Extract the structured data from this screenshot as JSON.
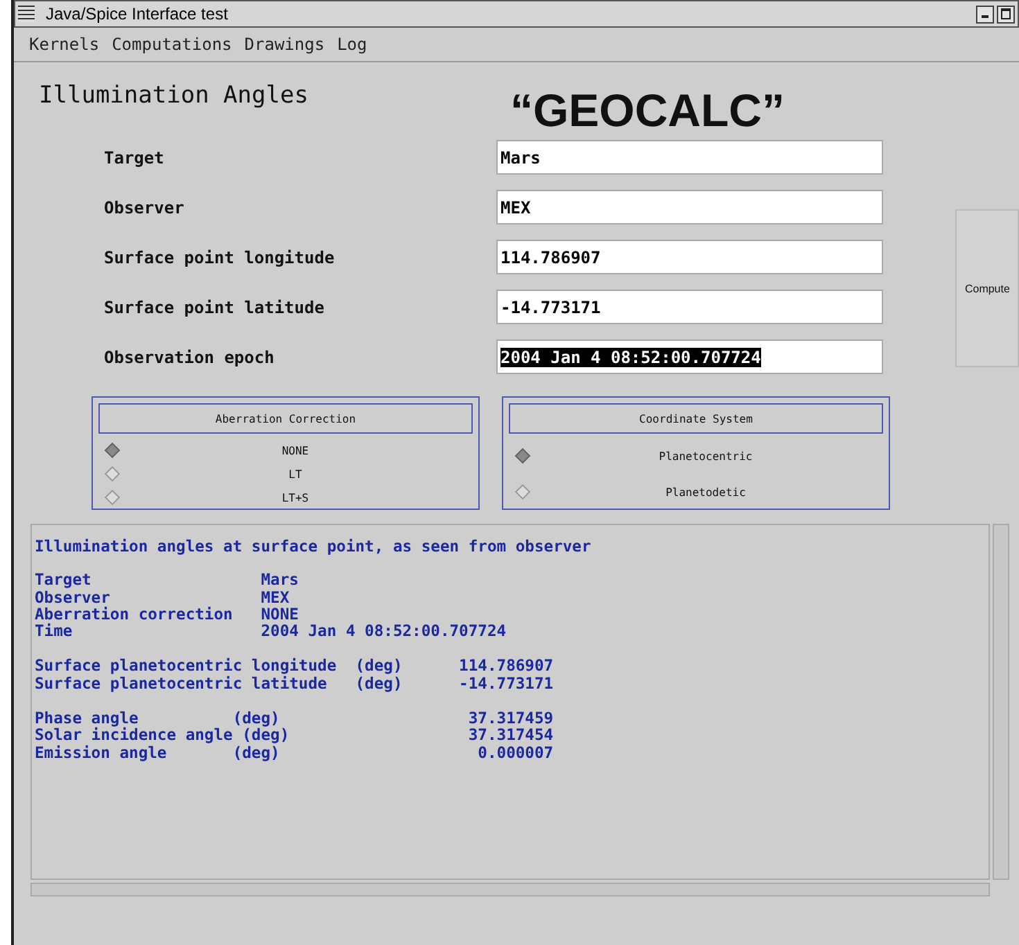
{
  "window": {
    "title": "Java/Spice Interface test"
  },
  "menu": [
    "Kernels",
    "Computations",
    "Drawings",
    "Log"
  ],
  "heading": "Illumination Angles",
  "banner": "“GEOCALC”",
  "fields": [
    {
      "label": "Target",
      "value": "Mars",
      "selected": false
    },
    {
      "label": "Observer",
      "value": "MEX",
      "selected": false
    },
    {
      "label": "Surface point longitude",
      "value": "114.786907",
      "selected": false
    },
    {
      "label": "Surface point latitude",
      "value": "-14.773171",
      "selected": false
    },
    {
      "label": "Observation epoch",
      "value": "2004 Jan 4 08:52:00.707724",
      "selected": true
    }
  ],
  "compute_button": "Compute",
  "groups": [
    {
      "title": "Aberration Correction",
      "options": [
        {
          "label": "NONE",
          "selected": true
        },
        {
          "label": "LT",
          "selected": false
        },
        {
          "label": "LT+S",
          "selected": false
        }
      ]
    },
    {
      "title": "Coordinate System",
      "options": [
        {
          "label": "Planetocentric",
          "selected": true
        },
        {
          "label": "Planetodetic",
          "selected": false
        }
      ]
    }
  ],
  "output": {
    "heading": "Illumination angles at surface point, as seen from observer",
    "blocks": [
      [
        "Target                  Mars",
        "Observer                MEX",
        "Aberration correction   NONE",
        "Time                    2004 Jan 4 08:52:00.707724"
      ],
      [
        "Surface planetocentric longitude  (deg)      114.786907",
        "Surface planetocentric latitude   (deg)      -14.773171"
      ],
      [
        "Phase angle          (deg)                    37.317459",
        "Solar incidence angle (deg)                   37.317454",
        "Emission angle       (deg)                     0.000007"
      ]
    ]
  }
}
